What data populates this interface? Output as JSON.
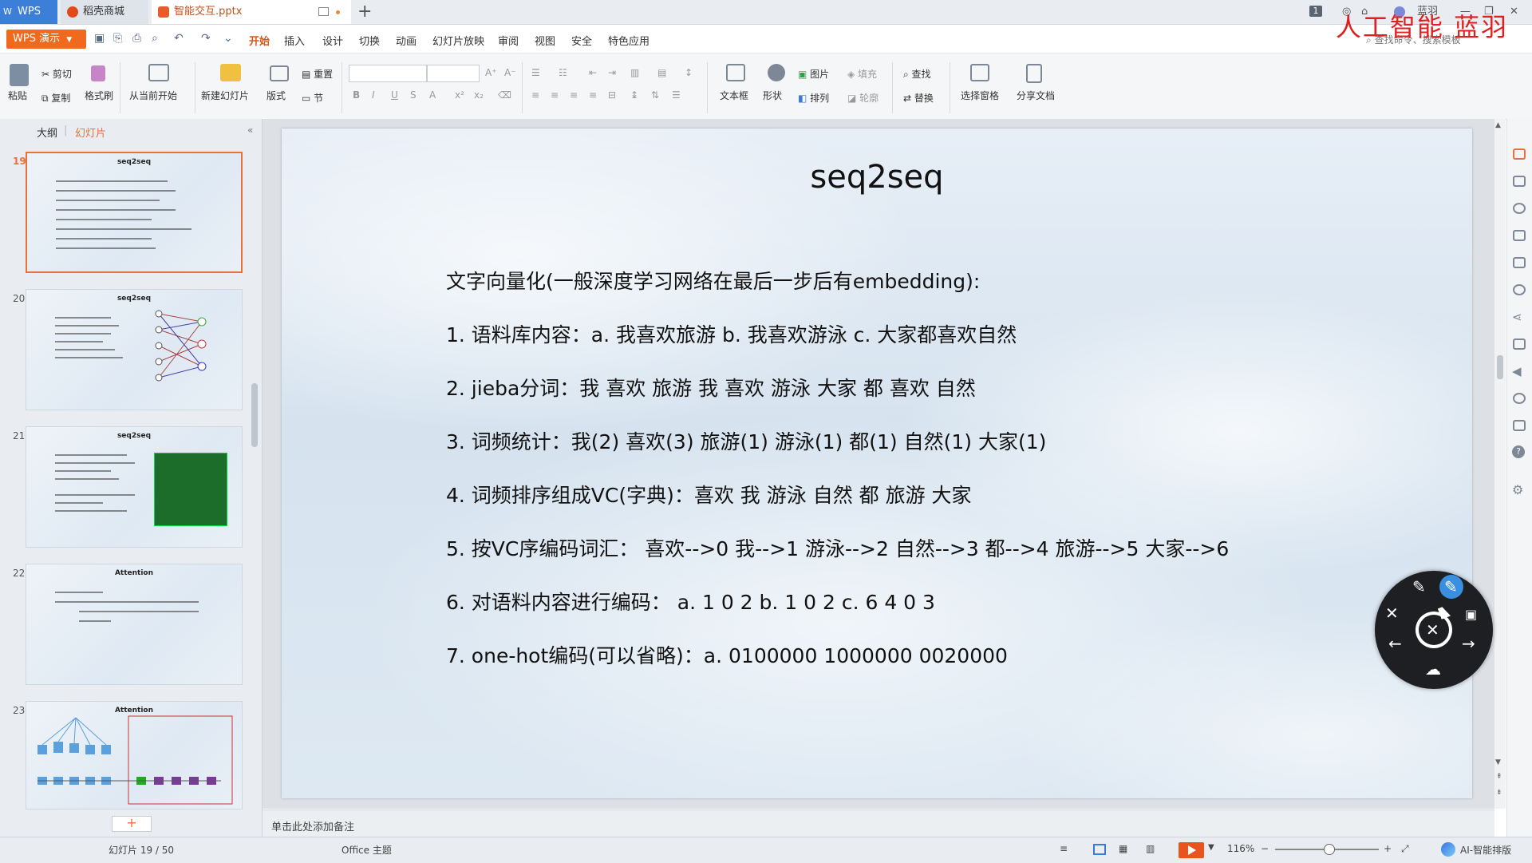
{
  "tabs": {
    "wps": "WPS",
    "store": "稻壳商城",
    "file": "智能交互.pptx",
    "new_tab": "+",
    "badge": "1",
    "user": "蓝羽"
  },
  "watermark": "人工智能  蓝羽",
  "menu": {
    "app_button": "WPS 演示",
    "items": [
      "开始",
      "插入",
      "设计",
      "切换",
      "动画",
      "幻灯片放映",
      "审阅",
      "视图",
      "安全",
      "特色应用"
    ],
    "search_placeholder": "查找命令、搜索模板"
  },
  "ribbon": {
    "paste": "粘贴",
    "cut": "剪切",
    "copy": "复制",
    "format_painter": "格式刷",
    "from_current": "从当前开始",
    "new_slide": "新建幻灯片",
    "layout": "版式",
    "reset": "重置",
    "section": "节",
    "textbox": "文本框",
    "shape": "形状",
    "picture": "图片",
    "fill": "填充",
    "arrange": "排列",
    "outline": "轮廓",
    "find": "查找",
    "replace": "替换",
    "selection_pane": "选择窗格",
    "share": "分享文档"
  },
  "left_panel": {
    "tab_outline": "大纲",
    "tab_slides": "幻灯片",
    "add_slide": "+",
    "thumbs": [
      {
        "num": "19",
        "title": "seq2seq"
      },
      {
        "num": "20",
        "title": "seq2seq"
      },
      {
        "num": "21",
        "title": "seq2seq"
      },
      {
        "num": "22",
        "title": "Attention"
      },
      {
        "num": "23",
        "title": "Attention"
      }
    ]
  },
  "slide": {
    "title": "seq2seq",
    "lines": [
      "文字向量化(一般深度学习网络在最后一步后有embedding):",
      "1.  语料库内容：a.  我喜欢旅游   b.  我喜欢游泳   c.  大家都喜欢自然",
      "2.  jieba分词：我 喜欢 旅游 我 喜欢 游泳 大家 都 喜欢 自然",
      "3.  词频统计：我(2)  喜欢(3)  旅游(1)  游泳(1)  都(1)  自然(1)  大家(1)",
      "4.  词频排序组成VC(字典)：喜欢 我  游泳 自然 都 旅游 大家",
      "5.  按VC序编码词汇：  喜欢-->0   我-->1  游泳-->2  自然-->3   都-->4  旅游-->5  大家-->6",
      "6.  对语料内容进行编码：  a.  1 0 2     b.  1 0 2     c. 6 4 0 3",
      "7.  one-hot编码(可以省略)：a. 0100000  1000000  0020000"
    ]
  },
  "notes_placeholder": "单击此处添加备注",
  "status": {
    "slide_counter": "幻灯片 19 / 50",
    "theme": "Office 主题",
    "zoom": "116%",
    "zoom_minus": "−",
    "zoom_plus": "+",
    "ai_layout": "AI-智能排版"
  }
}
